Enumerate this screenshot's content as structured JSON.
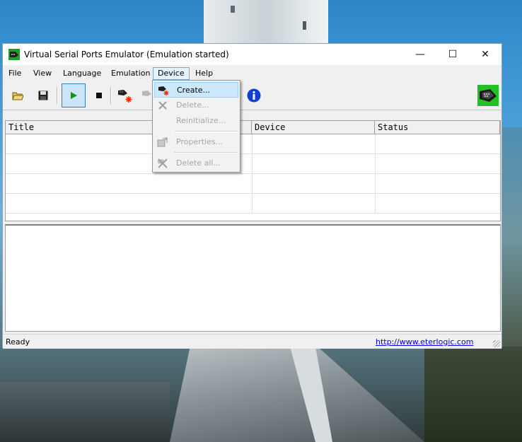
{
  "window": {
    "title": "Virtual Serial Ports Emulator (Emulation started)",
    "minimize_glyph": "—",
    "maximize_glyph": "☐",
    "close_glyph": "✕"
  },
  "menubar": {
    "items": [
      {
        "label": "File"
      },
      {
        "label": "View"
      },
      {
        "label": "Language"
      },
      {
        "label": "Emulation"
      },
      {
        "label": "Device",
        "open": true
      },
      {
        "label": "Help"
      }
    ]
  },
  "toolbar": {
    "icons": [
      "open-folder-icon",
      "save-icon",
      "start-emulation-icon",
      "stop-emulation-icon",
      "create-device-icon",
      "delete-device-icon",
      "info-icon",
      "serial-port-logo-icon"
    ]
  },
  "grid": {
    "columns": [
      {
        "label": "Title"
      },
      {
        "label": "Device"
      },
      {
        "label": "Status"
      }
    ],
    "rows": []
  },
  "device_menu": {
    "items": [
      {
        "label": "Create...",
        "enabled": true,
        "icon": "create-device-icon"
      },
      {
        "label": "Delete...",
        "enabled": false,
        "icon": "delete-icon"
      },
      {
        "label": "Reinitialize...",
        "enabled": false,
        "icon": ""
      },
      {
        "label": "Properties...",
        "enabled": false,
        "icon": "properties-icon"
      },
      {
        "label": "Delete all...",
        "enabled": false,
        "icon": "delete-all-icon"
      }
    ]
  },
  "statusbar": {
    "text": "Ready",
    "link": "http://www.eterlogic.com"
  },
  "colors": {
    "accent": "#0078d7",
    "menu_highlight": "#cce8ff",
    "play_green": "#1a8f1a",
    "info_blue": "#1040d0",
    "logo_green": "#22c022"
  }
}
